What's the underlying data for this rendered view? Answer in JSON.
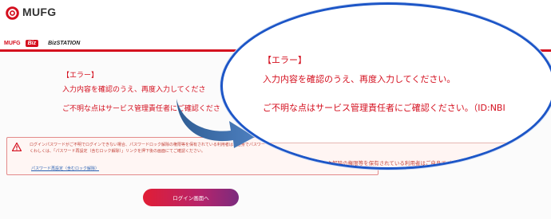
{
  "header": {
    "logo_text": "MUFG",
    "sub_mufg": "MUFG",
    "sub_biz": "Biz",
    "sub_bizstation": "BizSTATION",
    "accent_color": "#d40f1e"
  },
  "background_page": {
    "error_title": "【エラー】",
    "error_line1": "入力内容を確認のうえ、再度入力してくださ",
    "error_line2": "ご不明な点はサービス管理責任者にご確認くださ"
  },
  "alert": {
    "icon": "warning-triangle-icon",
    "line1": "ログインパスワードがご不明でログインできない場合、パスワードロック解除の権限等を保有されている利用者はご自身でパスワー",
    "line2": "くわしくは、「パスワード再設定（含むロック解除）」リンクを押下後の画面にてご確認ください。",
    "link_text": "パスワード再設定（含むロック解除）"
  },
  "login_button": {
    "label": "ログイン画面へ"
  },
  "magnifier": {
    "error_title": "【エラー】",
    "error_line1": "入力内容を確認のうえ、再度入力してください。",
    "error_line2": "ご不明な点はサービス管理責任者にご確認ください。（ID:NBI",
    "faded_text": "ロード ロック解除の権限等を保有されている利用者はご自身でパス"
  }
}
